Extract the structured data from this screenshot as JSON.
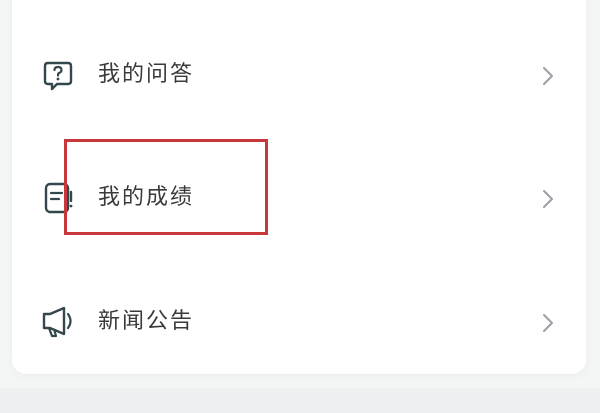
{
  "menu": {
    "items": [
      {
        "label": "我的问答",
        "icon": "question-bubble-icon"
      },
      {
        "label": "我的成绩",
        "icon": "report-card-icon"
      },
      {
        "label": "新闻公告",
        "icon": "megaphone-icon"
      }
    ]
  },
  "colors": {
    "icon": "#33484c",
    "label": "#3a3a3a",
    "chevron": "#9aa0a6",
    "highlight": "#c8383a",
    "card": "#ffffff",
    "background": "#f4f6f6"
  }
}
